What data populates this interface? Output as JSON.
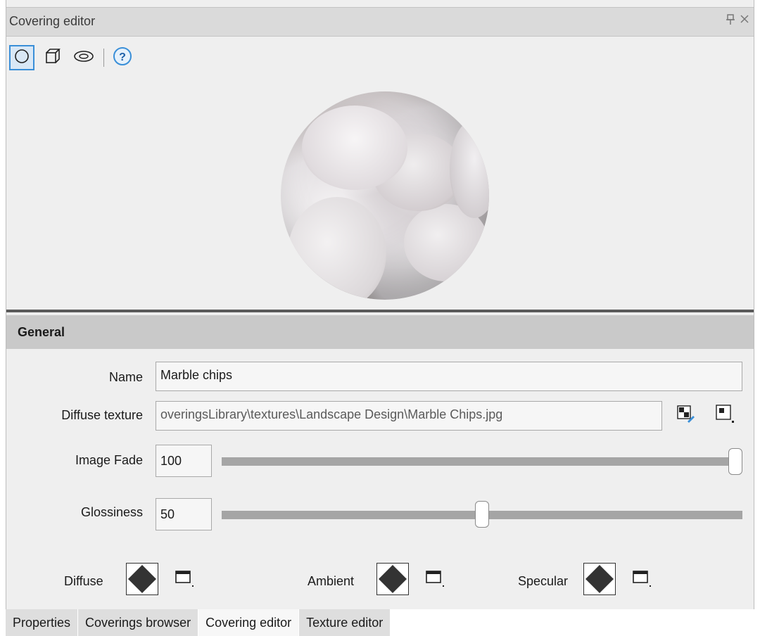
{
  "window": {
    "title": "Covering editor",
    "pin_glyph": "⸪",
    "close_glyph": "✕"
  },
  "toolbar": {
    "buttons": [
      {
        "icon": "sphere-preview-icon",
        "active": true
      },
      {
        "icon": "cube-preview-icon",
        "active": false
      },
      {
        "icon": "torus-preview-icon",
        "active": false
      },
      {
        "icon": "help-icon",
        "active": false
      }
    ],
    "help_glyph": "?"
  },
  "general": {
    "header": "General",
    "name_label": "Name",
    "name_value": "Marble chips",
    "diffuse_texture_label": "Diffuse texture",
    "diffuse_texture_value": "overingsLibrary\\textures\\Landscape Design\\Marble Chips.jpg",
    "image_fade_label": "Image Fade",
    "image_fade_value": "100",
    "image_fade_level": 1.0,
    "glossiness_label": "Glossiness",
    "glossiness_value": "50",
    "glossiness_level": 0.5
  },
  "colors": {
    "diffuse_label": "Diffuse",
    "ambient_label": "Ambient",
    "specular_label": "Specular",
    "swatch_color": "#333333"
  },
  "tabs": [
    {
      "label": "Properties",
      "active": false
    },
    {
      "label": "Coverings browser",
      "active": false
    },
    {
      "label": "Covering editor",
      "active": true
    },
    {
      "label": "Texture editor",
      "active": false
    }
  ],
  "accent_color": "#3a8fd8"
}
